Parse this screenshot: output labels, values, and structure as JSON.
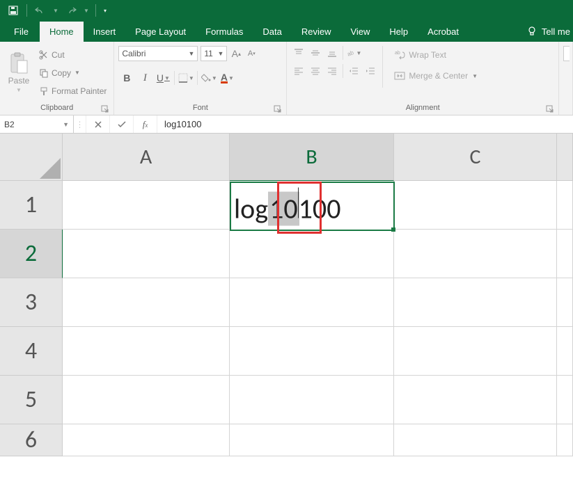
{
  "qat": {
    "save": "Save",
    "undo": "Undo",
    "redo": "Redo"
  },
  "tabs": {
    "file": "File",
    "home": "Home",
    "insert": "Insert",
    "page_layout": "Page Layout",
    "formulas": "Formulas",
    "data": "Data",
    "review": "Review",
    "view": "View",
    "help": "Help",
    "acrobat": "Acrobat",
    "tell_me": "Tell me"
  },
  "ribbon": {
    "clipboard": {
      "label": "Clipboard",
      "paste": "Paste",
      "cut": "Cut",
      "copy": "Copy",
      "format_painter": "Format Painter"
    },
    "font": {
      "label": "Font",
      "name": "Calibri",
      "size": "11",
      "bold": "B",
      "italic": "I",
      "underline": "U"
    },
    "alignment": {
      "label": "Alignment",
      "wrap": "Wrap Text",
      "merge": "Merge & Center"
    }
  },
  "formula_bar": {
    "name_box": "B2",
    "formula": "log10100"
  },
  "columns": {
    "a": "A",
    "b": "B",
    "c": "C"
  },
  "rows": {
    "r1": "1",
    "r2": "2",
    "r3": "3",
    "r4": "4",
    "r5": "5",
    "r6": "6"
  },
  "cell_b2": {
    "part1": "log",
    "part2_selected": "10",
    "part3": "100"
  }
}
